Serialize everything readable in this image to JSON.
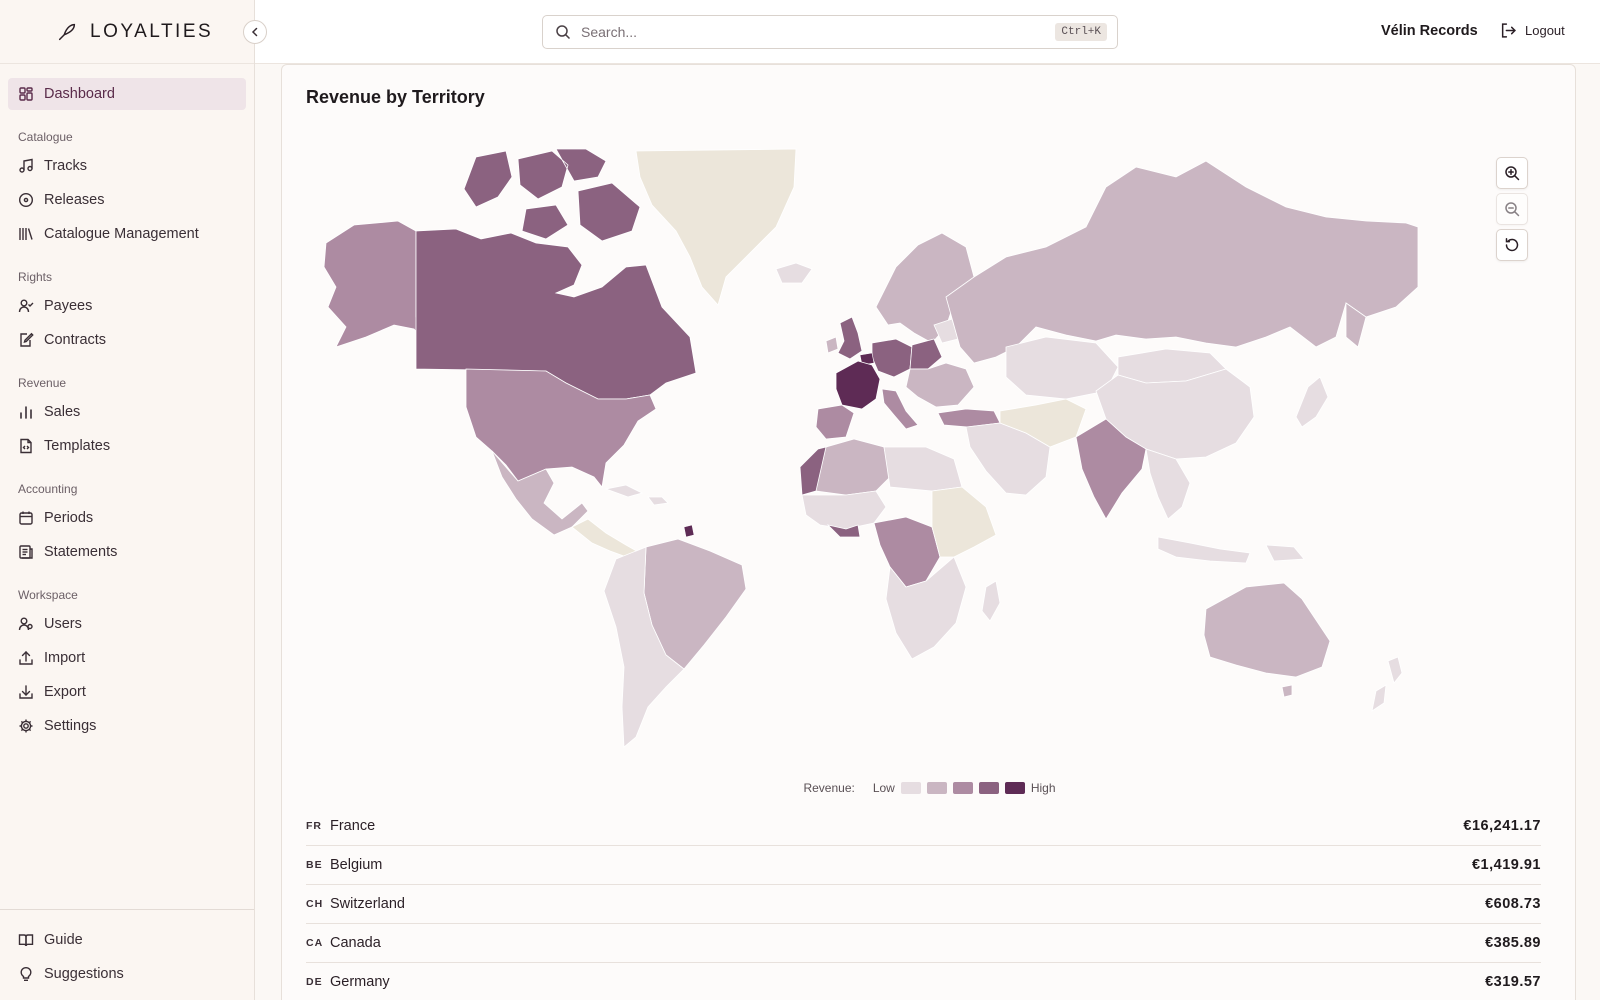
{
  "brand": {
    "name": "LOYALTIES"
  },
  "nav": {
    "dashboard": "Dashboard",
    "groups": {
      "catalogue": "Catalogue",
      "rights": "Rights",
      "revenue": "Revenue",
      "accounting": "Accounting",
      "workspace": "Workspace"
    },
    "tracks": "Tracks",
    "releases": "Releases",
    "catalogue_management": "Catalogue Management",
    "payees": "Payees",
    "contracts": "Contracts",
    "sales": "Sales",
    "templates": "Templates",
    "periods": "Periods",
    "statements": "Statements",
    "users": "Users",
    "import": "Import",
    "export": "Export",
    "settings": "Settings",
    "guide": "Guide",
    "suggestions": "Suggestions"
  },
  "header": {
    "search_placeholder": "Search...",
    "shortcut": "Ctrl+K",
    "org_name": "Vélin Records",
    "logout": "Logout"
  },
  "card": {
    "title": "Revenue by Territory"
  },
  "legend": {
    "label": "Revenue:",
    "low": "Low",
    "high": "High"
  },
  "colors": {
    "accent": "#5a2b4a",
    "scale": [
      "#e6dde1",
      "#cab6c2",
      "#ad8ba2",
      "#8b6280",
      "#5e2b55"
    ],
    "no_data": "#ece6da"
  },
  "territories": [
    {
      "code": "FR",
      "name": "France",
      "value": "€16,241.17"
    },
    {
      "code": "BE",
      "name": "Belgium",
      "value": "€1,419.91"
    },
    {
      "code": "CH",
      "name": "Switzerland",
      "value": "€608.73"
    },
    {
      "code": "CA",
      "name": "Canada",
      "value": "€385.89"
    },
    {
      "code": "DE",
      "name": "Germany",
      "value": "€319.57"
    }
  ]
}
